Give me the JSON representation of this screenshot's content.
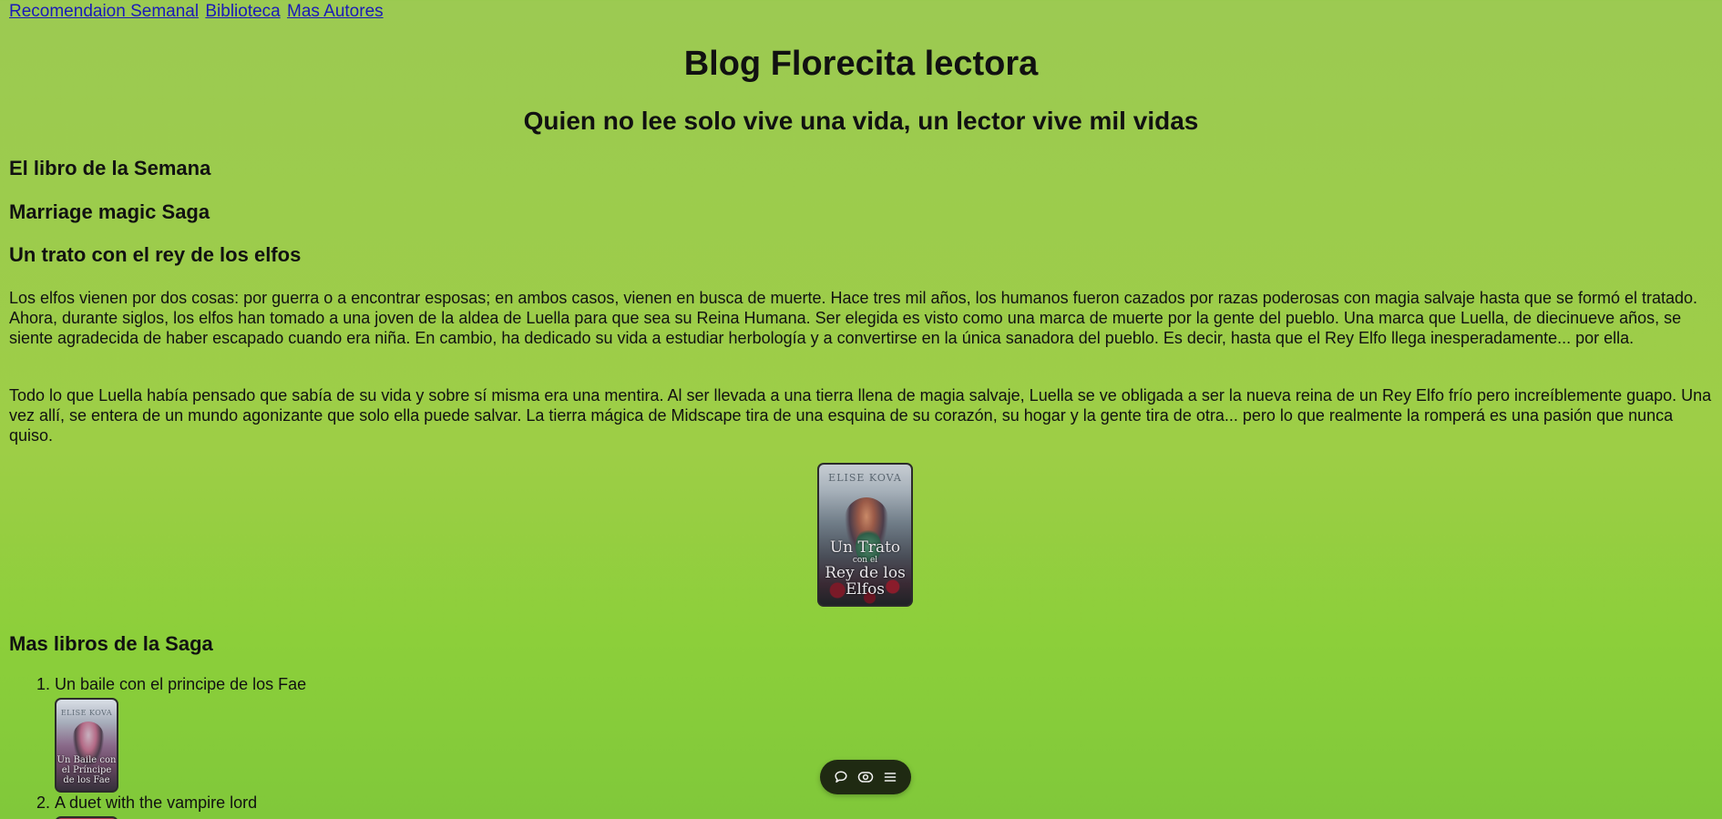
{
  "nav": {
    "links": [
      "Recomendaion Semanal",
      "Biblioteca",
      "Mas Autores"
    ]
  },
  "header": {
    "title": "Blog Florecita lectora",
    "subtitle": "Quien no lee solo vive una vida, un lector vive mil vidas"
  },
  "book_of_week": {
    "section_title": "El libro de la Semana",
    "saga": "Marriage magic Saga",
    "book_title": "Un trato con el rey de los elfos",
    "paragraphs": [
      "Los elfos vienen por dos cosas: por guerra o a encontrar esposas; en ambos casos, vienen en busca de muerte. Hace tres mil años, los humanos fueron cazados por razas poderosas con magia salvaje hasta que se formó el tratado. Ahora, durante siglos, los elfos han tomado a una joven de la aldea de Luella para que sea su Reina Humana. Ser elegida es visto como una marca de muerte por la gente del pueblo. Una marca que Luella, de diecinueve años, se siente agradecida de haber escapado cuando era niña. En cambio, ha dedicado su vida a estudiar herbología y a convertirse en la única sanadora del pueblo. Es decir, hasta que el Rey Elfo llega inesperadamente... por ella.",
      "Todo lo que Luella había pensado que sabía de su vida y sobre sí misma era una mentira. Al ser llevada a una tierra llena de magia salvaje, Luella se ve obligada a ser la nueva reina de un Rey Elfo frío pero increíblemente guapo. Una vez allí, se entera de un mundo agonizante que solo ella puede salvar. La tierra mágica de Midscape tira de una esquina de su corazón, su hogar y la gente tira de otra... pero lo que realmente la romperá es una pasión que nunca quiso."
    ],
    "cover": {
      "author": "ELISE KOVA",
      "title_lines": [
        "Un Trato",
        "con el",
        "Rey de los Elfos"
      ]
    }
  },
  "more_books": {
    "section_title": "Mas libros de la Saga",
    "items": [
      {
        "title": "Un baile con el principe de los Fae",
        "cover_author": "ELISE KOVA",
        "cover_title": "Un Baile con el Príncipe de los Fae"
      },
      {
        "title": "A duet with the vampire lord"
      }
    ]
  },
  "toolbar": {
    "icons": [
      "comment-icon",
      "eye-icon",
      "menu-icon"
    ]
  },
  "colors": {
    "background_top": "#9cca52",
    "background_bottom": "#80c83a",
    "link": "#1a1ab8",
    "toolbar_bg": "#1f2a12"
  }
}
